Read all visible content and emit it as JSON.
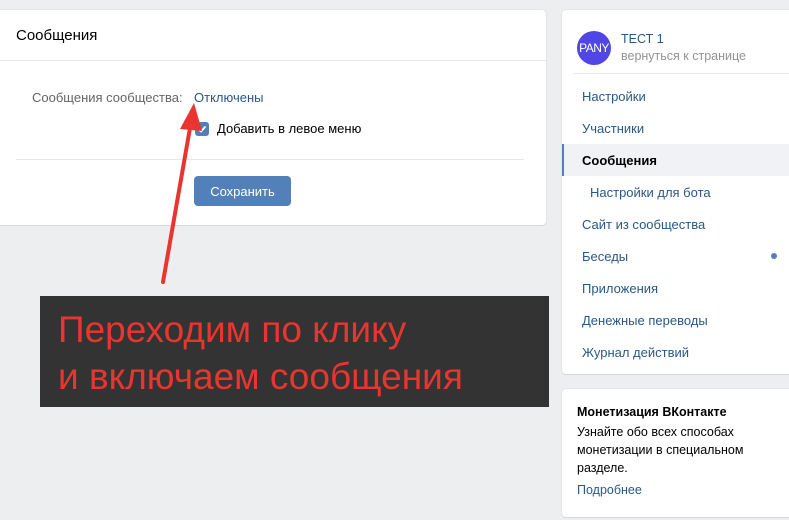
{
  "main": {
    "title": "Сообщения",
    "field_label": "Сообщения сообщества:",
    "field_value": "Отключены",
    "checkbox_label": "Добавить в левое меню",
    "checkbox_checked": true,
    "save_label": "Сохранить"
  },
  "sidebar": {
    "group_name": "ТЕСТ 1",
    "group_back": "вернуться к странице",
    "avatar_text": "PANY",
    "items": [
      {
        "label": "Настройки"
      },
      {
        "label": "Участники"
      },
      {
        "label": "Сообщения"
      },
      {
        "label": "Настройки для бота"
      },
      {
        "label": "Сайт из сообщества"
      },
      {
        "label": "Беседы"
      },
      {
        "label": "Приложения"
      },
      {
        "label": "Денежные переводы"
      },
      {
        "label": "Журнал действий"
      }
    ]
  },
  "promo": {
    "title": "Монетизация ВКонтакте",
    "text": "Узнайте обо всех способах монетизации в специальном разделе.",
    "link": "Подробнее"
  },
  "annotation": {
    "line1": "Переходим по клику",
    "line2": "и включаем сообщения"
  },
  "colors": {
    "accent": "#5181b8",
    "link": "#2a5885",
    "annotation_text": "#e8352f",
    "annotation_bg": "#333333"
  }
}
